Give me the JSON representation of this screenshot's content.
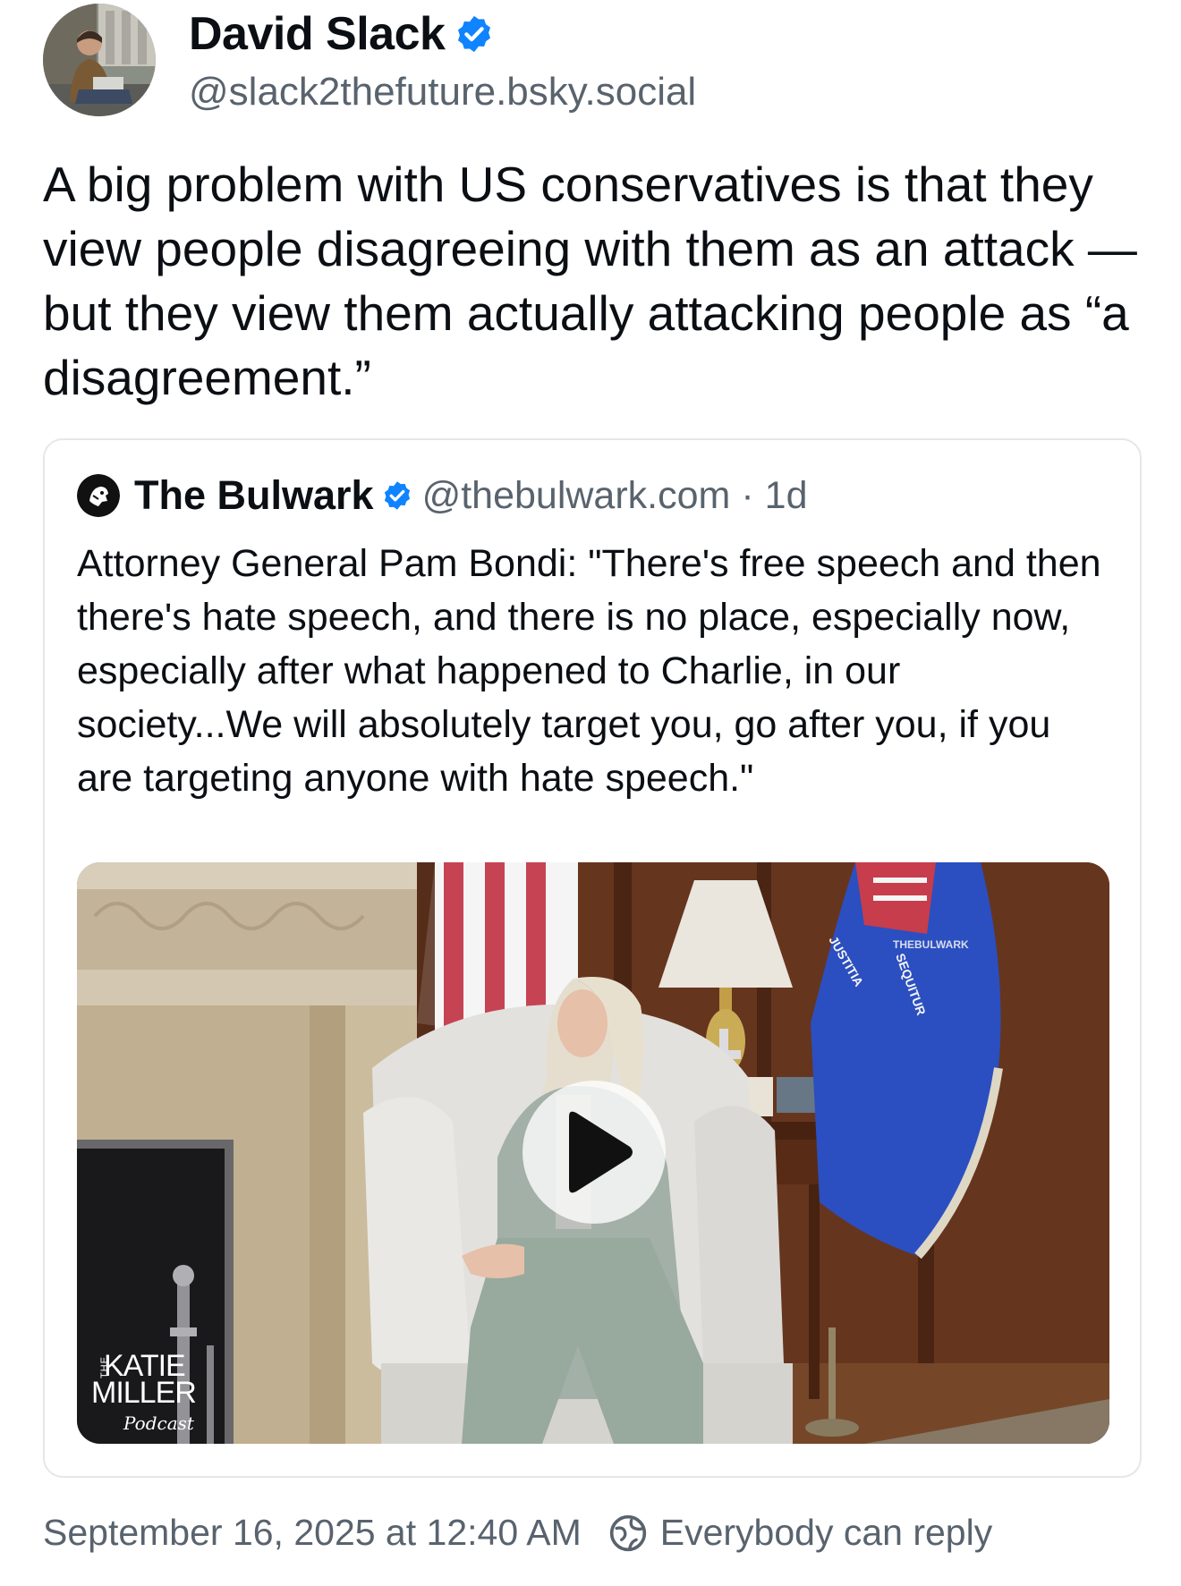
{
  "author": {
    "display_name": "David Slack",
    "handle": "@slack2thefuture.bsky.social"
  },
  "post": {
    "text": "A big problem with US conservatives is that they view people disagreeing with them as an attack — but they view them actually attacking people as “a disagreement.”"
  },
  "quote": {
    "display_name": "The Bulwark",
    "handle": "@thebulwark.com",
    "separator": "·",
    "time": "1d",
    "text": "Attorney General Pam Bondi: \"There's free speech and then there's hate speech, and there is no place, especially now, especially after what happened to Charlie, in our society...We will absolutely target you, go after you, if you are targeting anyone with hate speech.\"",
    "video": {
      "brand_the": "THE",
      "brand_katie": "KATIE",
      "brand_miller": "MILLER",
      "brand_podcast": "Podcast",
      "flag_left": "JUSTITIA",
      "flag_right": "SEQUITUR",
      "watermark": "THEBULWARK"
    }
  },
  "footer": {
    "timestamp": "September 16, 2025 at 12:40 AM",
    "reply_setting": "Everybody can reply"
  },
  "colors": {
    "verified": "#1083fe",
    "secondary_text": "#59636e",
    "border": "#e4e7ea"
  },
  "icons": [
    "verified-badge-icon",
    "play-icon",
    "reply-settings-icon"
  ]
}
